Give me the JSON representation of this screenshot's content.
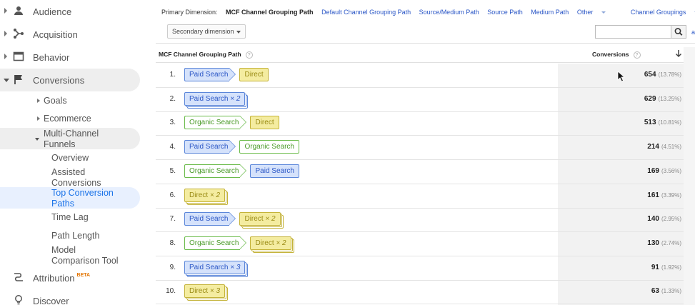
{
  "sidebar": {
    "top_items": [
      {
        "label": "Audience",
        "icon": "person-icon",
        "expanded": false
      },
      {
        "label": "Acquisition",
        "icon": "acquisition-icon",
        "expanded": false
      },
      {
        "label": "Behavior",
        "icon": "behavior-icon",
        "expanded": false
      },
      {
        "label": "Conversions",
        "icon": "flag-icon",
        "expanded": true
      }
    ],
    "conversion_subs": [
      "Goals",
      "Ecommerce",
      "Multi-Channel Funnels"
    ],
    "mcf_children": [
      "Overview",
      "Assisted Conversions",
      "Top Conversion Paths",
      "Time Lag",
      "Path Length",
      "Model Comparison Tool"
    ],
    "attribution": {
      "label": "Attribution",
      "badge": "BETA",
      "icon": "attribution-icon"
    },
    "discover": {
      "label": "Discover",
      "icon": "lightbulb-icon"
    }
  },
  "primary_dimension": {
    "label": "Primary Dimension:",
    "current": "MCF Channel Grouping Path",
    "links": [
      "Default Channel Grouping Path",
      "Source/Medium Path",
      "Source Path",
      "Medium Path"
    ],
    "other": "Other",
    "channel_groupings": "Channel Groupings"
  },
  "toolbar": {
    "secondary_dimension": "Secondary dimension",
    "search_placeholder": "",
    "advanced_partial": "a"
  },
  "table": {
    "col_path": "MCF Channel Grouping Path",
    "col_conv": "Conversions",
    "help_glyph": "?",
    "rows": [
      {
        "idx": "1.",
        "chips": [
          {
            "type": "paid",
            "label": "Paid Search",
            "mult": ""
          },
          {
            "type": "dir",
            "label": "Direct",
            "mult": ""
          }
        ],
        "value": "654",
        "pct": "(13.78%)"
      },
      {
        "idx": "2.",
        "chips": [
          {
            "type": "paid",
            "label": "Paid Search",
            "mult": "× 2"
          }
        ],
        "value": "629",
        "pct": "(13.25%)"
      },
      {
        "idx": "3.",
        "chips": [
          {
            "type": "org",
            "label": "Organic Search",
            "mult": ""
          },
          {
            "type": "dir",
            "label": "Direct",
            "mult": ""
          }
        ],
        "value": "513",
        "pct": "(10.81%)"
      },
      {
        "idx": "4.",
        "chips": [
          {
            "type": "paid",
            "label": "Paid Search",
            "mult": ""
          },
          {
            "type": "org",
            "label": "Organic Search",
            "mult": ""
          }
        ],
        "value": "214",
        "pct": "(4.51%)"
      },
      {
        "idx": "5.",
        "chips": [
          {
            "type": "org",
            "label": "Organic Search",
            "mult": ""
          },
          {
            "type": "paid",
            "label": "Paid Search",
            "mult": ""
          }
        ],
        "value": "169",
        "pct": "(3.56%)"
      },
      {
        "idx": "6.",
        "chips": [
          {
            "type": "dir",
            "label": "Direct",
            "mult": "× 2"
          }
        ],
        "value": "161",
        "pct": "(3.39%)"
      },
      {
        "idx": "7.",
        "chips": [
          {
            "type": "paid",
            "label": "Paid Search",
            "mult": ""
          },
          {
            "type": "dir",
            "label": "Direct",
            "mult": "× 2"
          }
        ],
        "value": "140",
        "pct": "(2.95%)"
      },
      {
        "idx": "8.",
        "chips": [
          {
            "type": "org",
            "label": "Organic Search",
            "mult": ""
          },
          {
            "type": "dir",
            "label": "Direct",
            "mult": "× 2"
          }
        ],
        "value": "130",
        "pct": "(2.74%)"
      },
      {
        "idx": "9.",
        "chips": [
          {
            "type": "paid",
            "label": "Paid Search",
            "mult": "× 3"
          }
        ],
        "value": "91",
        "pct": "(1.92%)"
      },
      {
        "idx": "10.",
        "chips": [
          {
            "type": "dir",
            "label": "Direct",
            "mult": "× 3"
          }
        ],
        "value": "63",
        "pct": "(1.33%)"
      }
    ]
  }
}
